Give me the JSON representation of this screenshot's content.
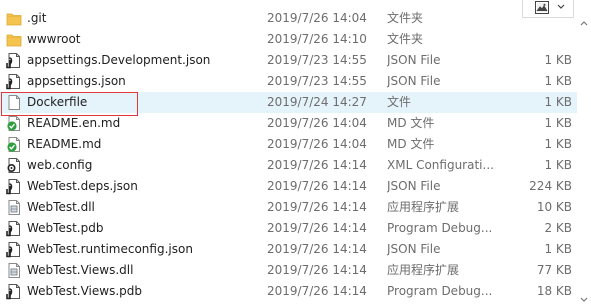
{
  "toolbar": {
    "preview_icon": "image-icon",
    "dropdown_icon": "chevron-down-icon"
  },
  "files": [
    {
      "name": ".git",
      "date": "2019/7/26 14:04",
      "type": "文件夹",
      "size": "",
      "icon": "folder-icon"
    },
    {
      "name": "wwwroot",
      "date": "2019/7/26 14:10",
      "type": "文件夹",
      "size": "",
      "icon": "folder-icon"
    },
    {
      "name": "appsettings.Development.json",
      "date": "2019/7/23 14:55",
      "type": "JSON File",
      "size": "1 KB",
      "icon": "json-file-icon"
    },
    {
      "name": "appsettings.json",
      "date": "2019/7/23 14:55",
      "type": "JSON File",
      "size": "1 KB",
      "icon": "json-file-icon"
    },
    {
      "name": "Dockerfile",
      "date": "2019/7/24 14:27",
      "type": "文件",
      "size": "1 KB",
      "icon": "blank-file-icon"
    },
    {
      "name": "README.en.md",
      "date": "2019/7/26 14:04",
      "type": "MD 文件",
      "size": "1 KB",
      "icon": "md-file-icon"
    },
    {
      "name": "README.md",
      "date": "2019/7/26 14:04",
      "type": "MD 文件",
      "size": "1 KB",
      "icon": "md-file-icon"
    },
    {
      "name": "web.config",
      "date": "2019/7/26 14:14",
      "type": "XML Configurati...",
      "size": "1 KB",
      "icon": "config-file-icon"
    },
    {
      "name": "WebTest.deps.json",
      "date": "2019/7/26 14:14",
      "type": "JSON File",
      "size": "224 KB",
      "icon": "json-file-icon"
    },
    {
      "name": "WebTest.dll",
      "date": "2019/7/26 14:14",
      "type": "应用程序扩展",
      "size": "10 KB",
      "icon": "dll-file-icon"
    },
    {
      "name": "WebTest.pdb",
      "date": "2019/7/26 14:14",
      "type": "Program Debug...",
      "size": "2 KB",
      "icon": "pdb-file-icon"
    },
    {
      "name": "WebTest.runtimeconfig.json",
      "date": "2019/7/26 14:14",
      "type": "JSON File",
      "size": "1 KB",
      "icon": "json-file-icon"
    },
    {
      "name": "WebTest.Views.dll",
      "date": "2019/7/26 14:14",
      "type": "应用程序扩展",
      "size": "77 KB",
      "icon": "dll-file-icon"
    },
    {
      "name": "WebTest.Views.pdb",
      "date": "2019/7/26 14:14",
      "type": "Program Debug...",
      "size": "18 KB",
      "icon": "pdb-file-icon"
    }
  ],
  "selected_index": 4,
  "colors": {
    "selection": "#e5f3fb",
    "highlight_box": "#e0383b",
    "folder": "#f5c44e",
    "md_badge": "#2e9e3e"
  }
}
